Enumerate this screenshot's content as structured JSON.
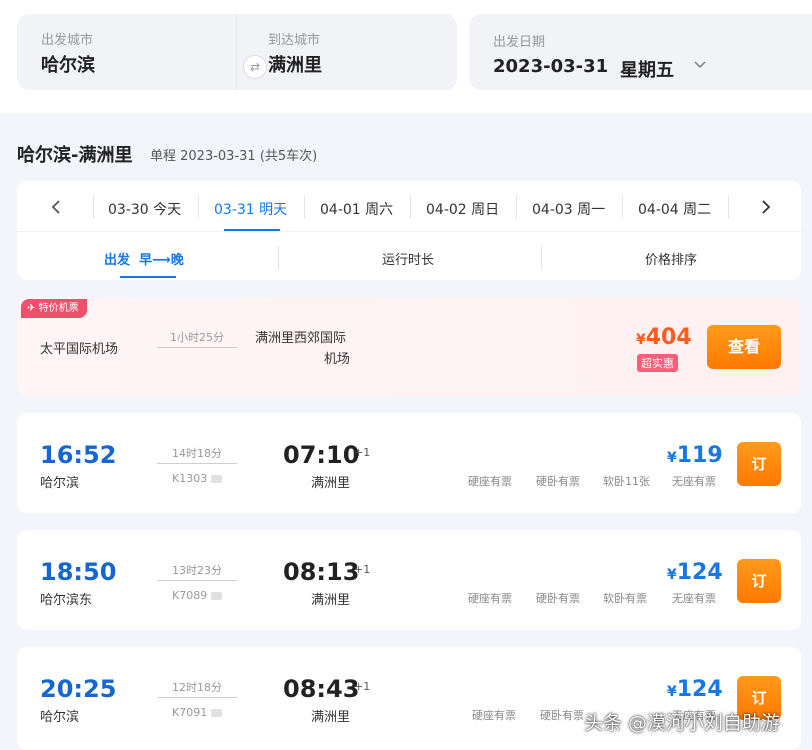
{
  "search": {
    "from_label": "出发城市",
    "from_value": "哈尔滨",
    "to_label": "到达城市",
    "to_value": "满洲里",
    "swap_icon": "⇄",
    "date_label": "出发日期",
    "date_value": "2023-03-31",
    "weekday_value": "星期五"
  },
  "route": {
    "title": "哈尔滨-满洲里",
    "subtitle": "单程 2023-03-31 (共5车次)"
  },
  "dates": [
    {
      "date": "03-30",
      "day": "今天"
    },
    {
      "date": "03-31",
      "day": "明天",
      "active": true
    },
    {
      "date": "04-01",
      "day": "周六"
    },
    {
      "date": "04-02",
      "day": "周日"
    },
    {
      "date": "04-03",
      "day": "周一"
    },
    {
      "date": "04-04",
      "day": "周二"
    }
  ],
  "sort": {
    "depart_label": "出发",
    "depart_order_early": "早",
    "depart_order_late": "晚",
    "duration_label": "运行时长",
    "price_label": "价格排序"
  },
  "flight": {
    "tag": "特价机票",
    "from": "太平国际机场",
    "duration": "1小时25分",
    "to_line1": "满洲里西郊国际",
    "to_line2": "机场",
    "currency": "¥",
    "price": "404",
    "badge": "超实惠",
    "button": "查看"
  },
  "trains": [
    {
      "dep": "16:52",
      "dep_station": "哈尔滨",
      "duration": "14时18分",
      "no": "K1303",
      "arr": "07:10",
      "plus": "+1",
      "arr_station": "满洲里",
      "seats": [
        "硬座有票",
        "硬卧有票",
        "软卧11张",
        "无座有票"
      ],
      "currency": "¥",
      "price": "119",
      "button": "订"
    },
    {
      "dep": "18:50",
      "dep_station": "哈尔滨东",
      "duration": "13时23分",
      "no": "K7089",
      "arr": "08:13",
      "plus": "+1",
      "arr_station": "满洲里",
      "seats": [
        "硬座有票",
        "硬卧有票",
        "软卧有票",
        "无座有票"
      ],
      "currency": "¥",
      "price": "124",
      "button": "订"
    },
    {
      "dep": "20:25",
      "dep_station": "哈尔滨",
      "duration": "12时18分",
      "no": "K7091",
      "arr": "08:43",
      "plus": "+1",
      "arr_station": "满洲里",
      "seats": [
        "硬座有票",
        "硬卧有票",
        "无座有票"
      ],
      "currency": "¥",
      "price": "124",
      "button": "订"
    }
  ],
  "watermark": "头条 @漠河小刘自助游",
  "colors": {
    "accent": "#1677e6",
    "orange": "#ff7a00",
    "red": "#f0506e"
  }
}
